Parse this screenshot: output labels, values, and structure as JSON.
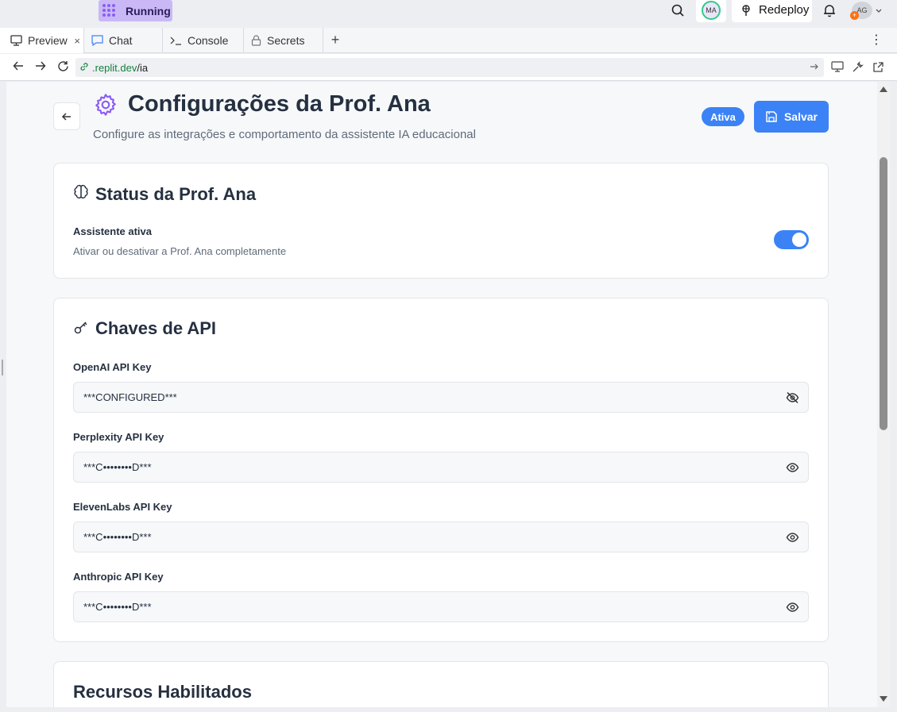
{
  "topbar": {
    "run_status": "Running",
    "user_initials": "MA",
    "redeploy_label": "Redeploy",
    "account_initials": "AG"
  },
  "tabs": [
    {
      "label": "Preview",
      "icon": "monitor-icon",
      "active": true
    },
    {
      "label": "Chat",
      "icon": "chat-icon",
      "active": false
    },
    {
      "label": "Console",
      "icon": "terminal-icon",
      "active": false
    },
    {
      "label": "Secrets",
      "icon": "lock-icon",
      "active": false
    }
  ],
  "address": {
    "host": ".replit.dev",
    "path": "/ia"
  },
  "page": {
    "title": "Configurações da Prof. Ana",
    "subtitle": "Configure as integrações e comportamento da assistente IA educacional",
    "status_badge": "Ativa",
    "save_label": "Salvar"
  },
  "status_card": {
    "title": "Status da Prof. Ana",
    "toggle_label": "Assistente ativa",
    "toggle_desc": "Ativar ou desativar a Prof. Ana completamente",
    "enabled": true
  },
  "api_card": {
    "title": "Chaves de API",
    "keys": [
      {
        "label": "OpenAI API Key",
        "value": "***CONFIGURED***",
        "icon": "eye-off-icon"
      },
      {
        "label": "Perplexity API Key",
        "value": "***C••••••••D***",
        "icon": "eye-icon"
      },
      {
        "label": "ElevenLabs API Key",
        "value": "***C••••••••D***",
        "icon": "eye-icon"
      },
      {
        "label": "Anthropic API Key",
        "value": "***C••••••••D***",
        "icon": "eye-icon"
      }
    ]
  },
  "features_card": {
    "title": "Recursos Habilitados"
  },
  "colors": {
    "accent": "#3b82f6",
    "gear": "#8b5cf6"
  }
}
